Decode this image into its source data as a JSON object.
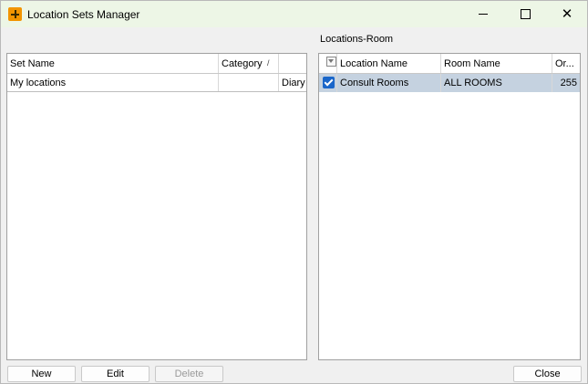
{
  "window": {
    "title": "Location Sets Manager",
    "app_icon": "plus-icon"
  },
  "title_controls": {
    "minimize_icon": "minimize-icon",
    "maximize_icon": "maximize-icon",
    "close_icon": "close-icon",
    "close_glyph": "✕"
  },
  "left_grid": {
    "columns": [
      {
        "label": "Set Name"
      },
      {
        "label": "Category",
        "sort_icon": "sort-ascending-icon",
        "sort_glyph": "/"
      },
      {
        "label": ""
      }
    ],
    "rows": [
      {
        "set_name": "My locations",
        "category": "",
        "type": "Diary"
      }
    ]
  },
  "right_section": {
    "label": "Locations-Room",
    "columns": [
      {
        "label": "",
        "icon": "filter-icon"
      },
      {
        "label": "Location Name"
      },
      {
        "label": "Room Name"
      },
      {
        "label": "Or..."
      }
    ],
    "rows": [
      {
        "checked": true,
        "location_name": "Consult Rooms",
        "room_name": "ALL ROOMS",
        "order": "255"
      }
    ],
    "selected_row_color": "#c5d2e0"
  },
  "buttons": {
    "new": "New",
    "edit": "Edit",
    "delete": "Delete",
    "close": "Close"
  }
}
